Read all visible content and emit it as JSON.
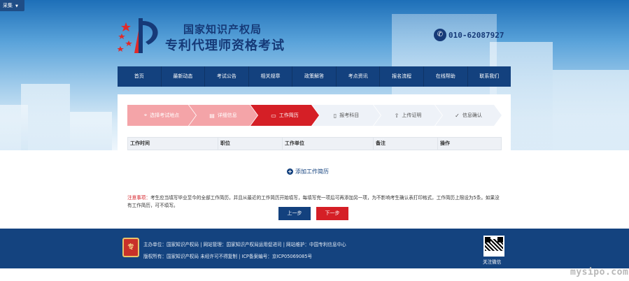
{
  "collect_button": "采集",
  "header": {
    "title1": "国家知识产权局",
    "title2": "专利代理师资格考试",
    "phone": "010-62087927"
  },
  "nav": [
    "首页",
    "最新动态",
    "考试公告",
    "相关规章",
    "政策解答",
    "考点资讯",
    "报名流程",
    "在线帮助",
    "联系我们"
  ],
  "steps": [
    {
      "label": "选择考试地点",
      "state": "done",
      "icon": "location-pin-icon"
    },
    {
      "label": "详细信息",
      "state": "done",
      "icon": "document-list-icon"
    },
    {
      "label": "工作简历",
      "state": "active",
      "icon": "folder-icon"
    },
    {
      "label": "报考科目",
      "state": "todo",
      "icon": "book-icon"
    },
    {
      "label": "上传证明",
      "state": "todo",
      "icon": "upload-icon"
    },
    {
      "label": "信息确认",
      "state": "todo",
      "icon": "check-circle-icon"
    }
  ],
  "table_headers": [
    "工作时间",
    "职位",
    "工作单位",
    "备注",
    "操作"
  ],
  "add_resume": "添加工作简历",
  "notice": {
    "label": "注意事项：",
    "text": "考生应当填写毕业至今的全部工作简历，并且从最近的工作简历开始填写，每填写完一项后可再添加另一项，为不影响考生确认表打印格式，工作简历上限设为5条。如果没有工作简历，可不填写。"
  },
  "buttons": {
    "prev": "上一步",
    "next": "下一步"
  },
  "footer": {
    "line1": "主办单位：国家知识产权局 | 网站管理：国家知识产权局运用促进司 | 网站维护：中国专利信息中心",
    "line2": "版权所有：国家知识产权局  未经许可不得复制 | ICP备案编号：京ICP05069085号",
    "emblem_text": "专",
    "qr_label": "关注微信"
  },
  "watermark": "mysipo.com",
  "colors": {
    "nav": "#13417e",
    "accent_red": "#d51f26",
    "step_done": "#f4a4a8",
    "footer": "#14437f"
  }
}
